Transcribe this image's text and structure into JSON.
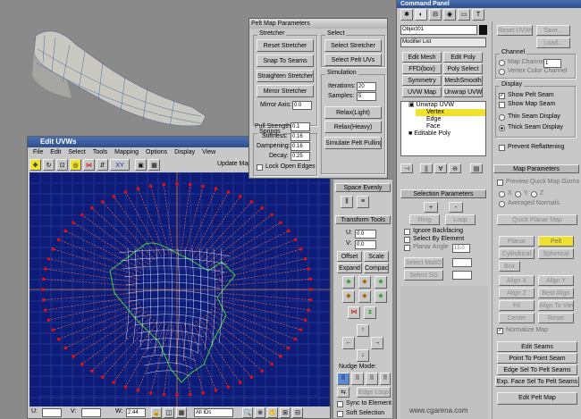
{
  "pelt": {
    "title": "Pelt Map Parameters",
    "stretcher_group": "Stretcher",
    "select_group": "Select",
    "reset_stretcher": "Reset Stretcher",
    "snap_to_seams": "Snap To Seams",
    "straighten_stretcher": "Straighten Stretcher",
    "mirror_stretcher": "Mirror Stretcher",
    "mirror_axis_label": "Mirror Axis:",
    "mirror_axis_value": "0.0",
    "select_stretcher": "Select Stretcher",
    "select_pelt_uvs": "Select Pelt UVs",
    "simulation_group": "Simulation",
    "iterations_label": "Iterations:",
    "iterations_value": "20",
    "samples_label": "Samples:",
    "samples_value": "5",
    "springs_group": "Springs",
    "pull_strength_label": "Pull Strength:",
    "pull_strength_value": "0.1",
    "stiffness_label": "Stiffness:",
    "stiffness_value": "0.16",
    "dampening_label": "Dampening:",
    "dampening_value": "0.16",
    "decay_label": "Decay:",
    "decay_value": "0.25",
    "lock_open_edges": "Lock Open Edges",
    "relax_light": "Relax(Light)",
    "relax_heavy": "Relax(Heavy)",
    "simulate": "Simulate Pelt Pulling"
  },
  "edit_uvws": {
    "title": "Edit UVWs",
    "menu": [
      "File",
      "Edit",
      "Select",
      "Tools",
      "Mapping",
      "Options",
      "Display",
      "View"
    ],
    "update_map": "Update Map",
    "bottom": {
      "u_label": "U:",
      "v_label": "V:",
      "w_label": "W:",
      "w_value": "2.44",
      "ids": "All IDs"
    }
  },
  "tools_panel": {
    "space_evenly": "Space Evenly",
    "transform_tools": "Transform Tools",
    "u_label": "U:",
    "u_value": "0.0",
    "v_label": "V:",
    "v_value": "0.0",
    "offset": "Offset",
    "scale": "Scale",
    "expand": "Expand",
    "compact": "Compact",
    "nudge_mode": "Nudge Mode:",
    "edge_loop": "Edge Loop",
    "sync_to_element": "Sync to Element",
    "soft_selection": "Soft Selection"
  },
  "command": {
    "title": "Command Panel",
    "object_name": "Object01",
    "modifier_list": "Modifier List",
    "mod_buttons": [
      "Edit Mesh",
      "Edit Poly",
      "FFD(box)",
      "Poly Select",
      "Symmetry",
      "MeshSmooth",
      "UVW Map",
      "Unwrap UVW"
    ],
    "stack": [
      "Unwrap UVW",
      "Vertex",
      "Edge",
      "Face",
      "Editable Poly"
    ],
    "reset_uvws": "Reset UVWs",
    "save": "Save...",
    "load": "Load...",
    "channel_group": "Channel",
    "map_channel": "Map Channel:",
    "map_channel_value": "1",
    "vertex_color_channel": "Vertex Color Channel",
    "display_group": "Display",
    "show_pelt_seam": "Show Pelt Seam",
    "show_map_seam": "Show Map Seam",
    "thin_seam": "Thin Seam Display",
    "thick_seam": "Thick Seam Display",
    "prevent_reflattening": "Prevent Reflattening",
    "selection_parameters": "Selection Parameters",
    "ring": "Ring",
    "loop": "Loop",
    "ignore_backfacing": "Ignore Backfacing",
    "select_by_element": "Select By Element",
    "planar_angle": "Planar Angle",
    "planar_angle_value": "15.0",
    "select_matid": "Select MatID",
    "select_sg": "Select SG",
    "map_parameters": "Map Parameters",
    "preview_quick_map": "Preview Quick Map Gizmo",
    "xyz": [
      "X",
      "Y",
      "Z"
    ],
    "averaged_normals": "Averaged Normals",
    "quick_planar_map": "Quick Planar Map",
    "planar": "Planar",
    "pelt": "Pelt",
    "cylindrical": "Cylindrical",
    "spherical": "Spherical",
    "box": "Box",
    "align_x": "Align X",
    "align_y": "Align Y",
    "align_z": "Align Z",
    "best_align": "Best Align",
    "fit": "Fit",
    "align_to_view": "Align To View",
    "center": "Center",
    "reset": "Reset",
    "normalize_map": "Normalize Map",
    "edit_seams": "Edit Seams",
    "point_to_point_seam": "Point To Point Seam",
    "edge_sel_to_pelt": "Edge Sel To Pelt Seams",
    "exp_face_sel": "Exp. Face Sel To Pelt Seams",
    "edit_pelt_map": "Edit Pelt Map"
  },
  "watermark": "www.cgarena.com",
  "colors": {
    "accent_yellow": "#f0e030",
    "title_blue": "#2c4f8e",
    "uv_bg": "#0d1c78",
    "seam_red": "#e01010"
  }
}
